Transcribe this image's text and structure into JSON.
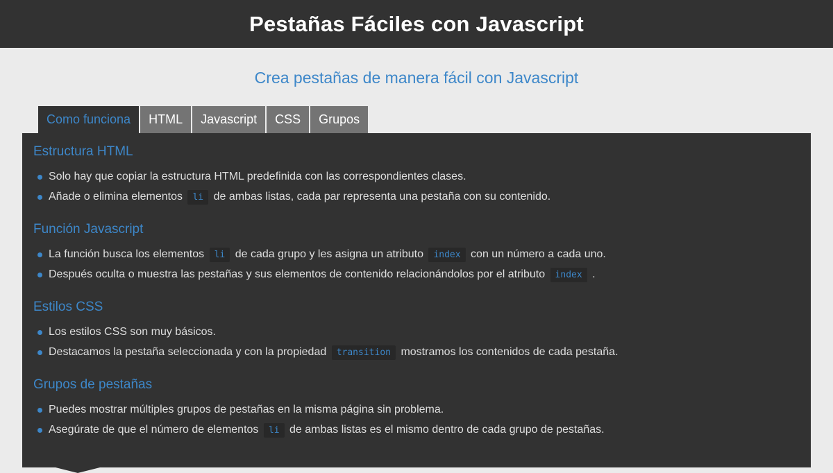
{
  "header": {
    "title": "Pestañas Fáciles con Javascript"
  },
  "subtitle": "Crea pestañas de manera fácil con Javascript",
  "tabs": [
    {
      "label": "Como funciona",
      "active": true
    },
    {
      "label": "HTML",
      "active": false
    },
    {
      "label": "Javascript",
      "active": false
    },
    {
      "label": "CSS",
      "active": false
    },
    {
      "label": "Grupos",
      "active": false
    }
  ],
  "sections": [
    {
      "title": "Estructura HTML",
      "items": [
        {
          "before": "Solo hay que copiar la estructura HTML predefinida con las correspondientes clases."
        },
        {
          "before": "Añade o elimina elementos",
          "code": "li",
          "after": "de ambas listas, cada par representa una pestaña con su contenido."
        }
      ]
    },
    {
      "title": "Función Javascript",
      "items": [
        {
          "before": "La función busca los elementos",
          "code": "li",
          "after": "de cada grupo y les asigna un atributo",
          "code2": "index",
          "after2": "con un número a cada uno."
        },
        {
          "before": "Después oculta o muestra las pestañas y sus elementos de contenido relacionándolos por el atributo",
          "code": "index",
          "after": "."
        }
      ]
    },
    {
      "title": "Estilos CSS",
      "items": [
        {
          "before": "Los estilos CSS son muy básicos."
        },
        {
          "before": "Destacamos la pestaña seleccionada y con la propiedad",
          "code": "transition",
          "after": "mostramos los contenidos de cada pestaña."
        }
      ]
    },
    {
      "title": "Grupos de pestañas",
      "items": [
        {
          "before": "Puedes mostrar múltiples grupos de pestañas en la misma página sin problema."
        },
        {
          "before": "Asegúrate de que el número de elementos",
          "code": "li",
          "after": "de ambas listas es el mismo dentro de cada grupo de pestañas."
        }
      ]
    }
  ],
  "colors": {
    "accent": "#3d87c9",
    "dark": "#323232",
    "tab_inactive": "#747474",
    "background": "#ebebeb"
  }
}
